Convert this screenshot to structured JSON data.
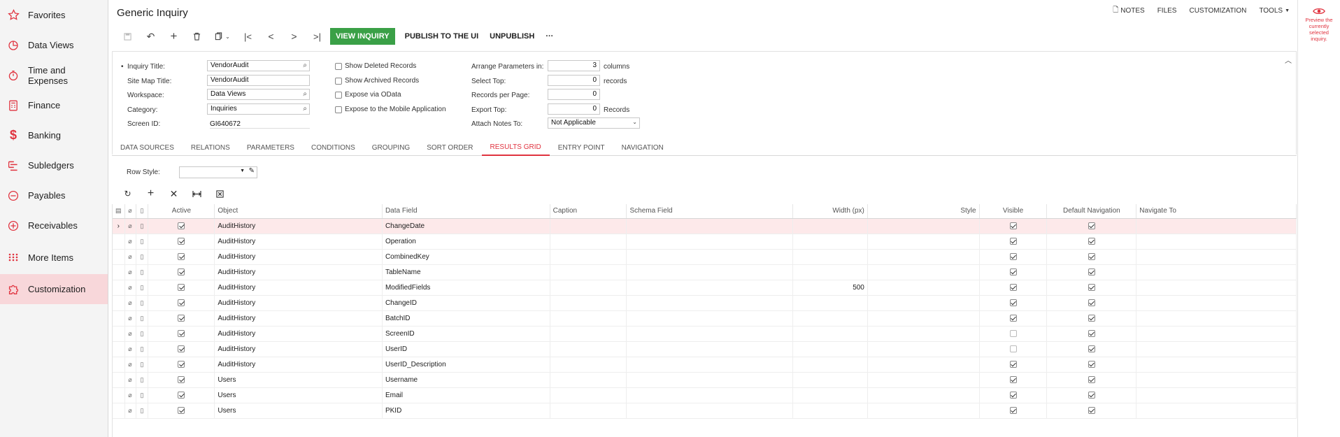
{
  "sidebar": {
    "items": [
      {
        "label": "Favorites",
        "icon": "star-icon"
      },
      {
        "label": "Data Views",
        "icon": "pie-chart-icon"
      },
      {
        "label": "Time and Expenses",
        "icon": "stopwatch-icon"
      },
      {
        "label": "Finance",
        "icon": "calculator-icon"
      },
      {
        "label": "Banking",
        "icon": "dollar-icon"
      },
      {
        "label": "Subledgers",
        "icon": "subledgers-icon"
      },
      {
        "label": "Payables",
        "icon": "minus-circle-icon"
      },
      {
        "label": "Receivables",
        "icon": "plus-circle-icon"
      },
      {
        "label": "More Items",
        "icon": "grid-dots-icon"
      },
      {
        "label": "Customization",
        "icon": "puzzle-icon"
      }
    ]
  },
  "header": {
    "title": "Generic Inquiry",
    "nav": [
      "NOTES",
      "FILES",
      "CUSTOMIZATION",
      "TOOLS"
    ]
  },
  "toolbar": {
    "view_inquiry": "VIEW INQUIRY",
    "publish": "PUBLISH TO THE UI",
    "unpublish": "UNPUBLISH",
    "more": "···"
  },
  "form": {
    "inquiry_title_label": "Inquiry Title:",
    "inquiry_title": "VendorAudit",
    "site_map_title_label": "Site Map Title:",
    "site_map_title": "VendorAudit",
    "workspace_label": "Workspace:",
    "workspace": "Data Views",
    "category_label": "Category:",
    "category": "Inquiries",
    "screen_id_label": "Screen ID:",
    "screen_id": "GI640672",
    "show_deleted": "Show Deleted Records",
    "show_archived": "Show Archived Records",
    "expose_odata": "Expose via OData",
    "expose_mobile": "Expose to the Mobile Application",
    "arrange_label": "Arrange Parameters in:",
    "arrange_value": "3",
    "arrange_unit": "columns",
    "select_top_label": "Select Top:",
    "select_top_value": "0",
    "select_top_unit": "records",
    "records_page_label": "Records per Page:",
    "records_page_value": "0",
    "export_top_label": "Export Top:",
    "export_top_value": "0",
    "export_top_unit": "Records",
    "attach_notes_label": "Attach Notes To:",
    "attach_notes_value": "Not Applicable"
  },
  "tabs": [
    "DATA SOURCES",
    "RELATIONS",
    "PARAMETERS",
    "CONDITIONS",
    "GROUPING",
    "SORT ORDER",
    "RESULTS GRID",
    "ENTRY POINT",
    "NAVIGATION"
  ],
  "active_tab": "RESULTS GRID",
  "row_style_label": "Row Style:",
  "preview": {
    "line1": "Preview the",
    "line2": "currently",
    "line3": "selected",
    "line4": "inquiry."
  },
  "grid": {
    "columns": [
      "Active",
      "Object",
      "Data Field",
      "Caption",
      "Schema Field",
      "Width (px)",
      "Style",
      "Visible",
      "Default Navigation",
      "Navigate To"
    ],
    "rows": [
      {
        "active": true,
        "object": "AuditHistory",
        "data_field": "ChangeDate",
        "width": "",
        "visible": true,
        "default_nav": true
      },
      {
        "active": true,
        "object": "AuditHistory",
        "data_field": "Operation",
        "width": "",
        "visible": true,
        "default_nav": true
      },
      {
        "active": true,
        "object": "AuditHistory",
        "data_field": "CombinedKey",
        "width": "",
        "visible": true,
        "default_nav": true
      },
      {
        "active": true,
        "object": "AuditHistory",
        "data_field": "TableName",
        "width": "",
        "visible": true,
        "default_nav": true
      },
      {
        "active": true,
        "object": "AuditHistory",
        "data_field": "ModifiedFields",
        "width": "500",
        "visible": true,
        "default_nav": true
      },
      {
        "active": true,
        "object": "AuditHistory",
        "data_field": "ChangeID",
        "width": "",
        "visible": true,
        "default_nav": true
      },
      {
        "active": true,
        "object": "AuditHistory",
        "data_field": "BatchID",
        "width": "",
        "visible": true,
        "default_nav": true
      },
      {
        "active": true,
        "object": "AuditHistory",
        "data_field": "ScreenID",
        "width": "",
        "visible": false,
        "default_nav": true
      },
      {
        "active": true,
        "object": "AuditHistory",
        "data_field": "UserID",
        "width": "",
        "visible": false,
        "default_nav": true
      },
      {
        "active": true,
        "object": "AuditHistory",
        "data_field": "UserID_Description",
        "width": "",
        "visible": true,
        "default_nav": true
      },
      {
        "active": true,
        "object": "Users",
        "data_field": "Username",
        "width": "",
        "visible": true,
        "default_nav": true
      },
      {
        "active": true,
        "object": "Users",
        "data_field": "Email",
        "width": "",
        "visible": true,
        "default_nav": true
      },
      {
        "active": true,
        "object": "Users",
        "data_field": "PKID",
        "width": "",
        "visible": true,
        "default_nav": true
      }
    ]
  },
  "colors": {
    "accent": "#e0333f",
    "green": "#3aa047",
    "selected_row": "#fde9ea",
    "active_nav": "#f8d7da"
  }
}
